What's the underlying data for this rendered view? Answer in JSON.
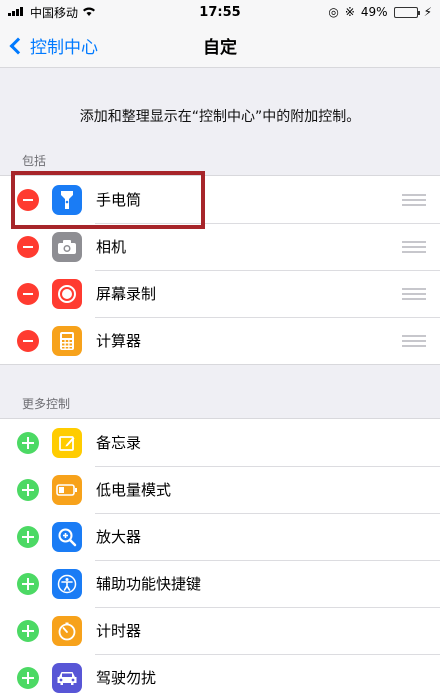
{
  "status_bar": {
    "carrier": "中国移动",
    "time": "17:55",
    "battery_percent": "49%",
    "battery_level": 0.49
  },
  "nav": {
    "back_label": "控制中心",
    "title": "自定"
  },
  "description": "添加和整理显示在“控制中心”中的附加控制。",
  "included": {
    "header": "包括",
    "items": [
      {
        "label": "手电筒",
        "icon": "flashlight-icon",
        "color": "#1a7cf5"
      },
      {
        "label": "相机",
        "icon": "camera-icon",
        "color": "#8e8e93"
      },
      {
        "label": "屏幕录制",
        "icon": "screen-record-icon",
        "color": "#ff3b30"
      },
      {
        "label": "计算器",
        "icon": "calculator-icon",
        "color": "#f7a21b"
      }
    ]
  },
  "more": {
    "header": "更多控制",
    "items": [
      {
        "label": "备忘录",
        "icon": "notes-icon",
        "color": "#ffcc00"
      },
      {
        "label": "低电量模式",
        "icon": "low-power-icon",
        "color": "#f7a21b"
      },
      {
        "label": "放大器",
        "icon": "magnifier-icon",
        "color": "#1a7cf5"
      },
      {
        "label": "辅助功能快捷键",
        "icon": "accessibility-icon",
        "color": "#1a7cf5"
      },
      {
        "label": "计时器",
        "icon": "timer-icon",
        "color": "#f7a21b"
      },
      {
        "label": "驾驶勿扰",
        "icon": "car-icon",
        "color": "#5856d6"
      }
    ]
  },
  "colors": {
    "accent": "#007aff",
    "remove": "#ff3b30",
    "add": "#4cd964",
    "highlight_box": "#a7252a"
  }
}
